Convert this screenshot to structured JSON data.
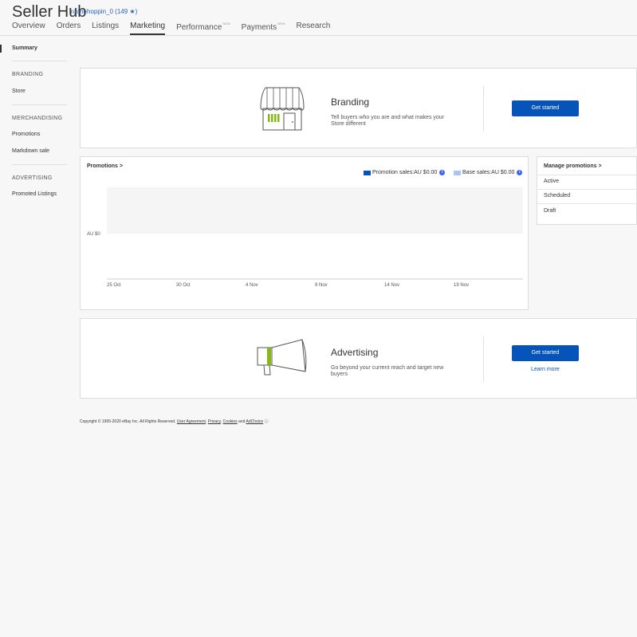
{
  "header": {
    "title": "Seller Hub",
    "user": "rachehoppin_0",
    "user_rating": "(149 ★)",
    "tabs": [
      {
        "label": "Overview"
      },
      {
        "label": "Orders"
      },
      {
        "label": "Listings"
      },
      {
        "label": "Marketing",
        "active": true
      },
      {
        "label": "Performance",
        "badge": "NEW"
      },
      {
        "label": "Payments",
        "badge": "NEW"
      },
      {
        "label": "Research"
      }
    ]
  },
  "sidebar": {
    "summary": "Summary",
    "branding_heading": "BRANDING",
    "store": "Store",
    "merch_heading": "MERCHANDISING",
    "promotions": "Promotions",
    "markdown": "Markdown sale",
    "adv_heading": "ADVERTISING",
    "promoted": "Promoted Listings"
  },
  "branding": {
    "title": "Branding",
    "description": "Tell buyers who you are and what makes your Store different",
    "button": "Get started"
  },
  "promotions": {
    "title": "Promotions",
    "chevron": ">",
    "legend": [
      {
        "label": "Promotion sales:AU $0.00",
        "color": "#0654ba"
      },
      {
        "label": "Base sales:AU $0.00",
        "color": "#a7c8ec"
      }
    ],
    "info_glyph": "i"
  },
  "chart_data": {
    "type": "bar",
    "categories": [
      "25 Oct",
      "30 Oct",
      "4 Nov",
      "9 Nov",
      "14 Nov",
      "19 Nov"
    ],
    "series": [
      {
        "name": "Promotion sales",
        "values": [
          0,
          0,
          0,
          0,
          0,
          0
        ]
      },
      {
        "name": "Base sales",
        "values": [
          0,
          0,
          0,
          0,
          0,
          0
        ]
      }
    ],
    "y_tick": "AU $0",
    "legend_position": "top-right"
  },
  "manage": {
    "title": "Manage promotions",
    "chevron": ">",
    "items": [
      "Active",
      "Scheduled",
      "Draft"
    ]
  },
  "advertising": {
    "title": "Advertising",
    "description": "Go beyond your current reach and target new buyers",
    "button": "Get started",
    "learn_more": "Learn more"
  },
  "footer": {
    "copyright": "Copyright © 1995-2020 eBay Inc. All Rights Reserved.",
    "user_agreement": "User Agreement",
    "privacy": "Privacy",
    "cookies": "Cookies",
    "and": "and",
    "adchoice": "AdChoice",
    "adchoice_glyph": "ⓘ"
  },
  "colors": {
    "accent": "#0654ba",
    "accent_green": "#86b817"
  }
}
